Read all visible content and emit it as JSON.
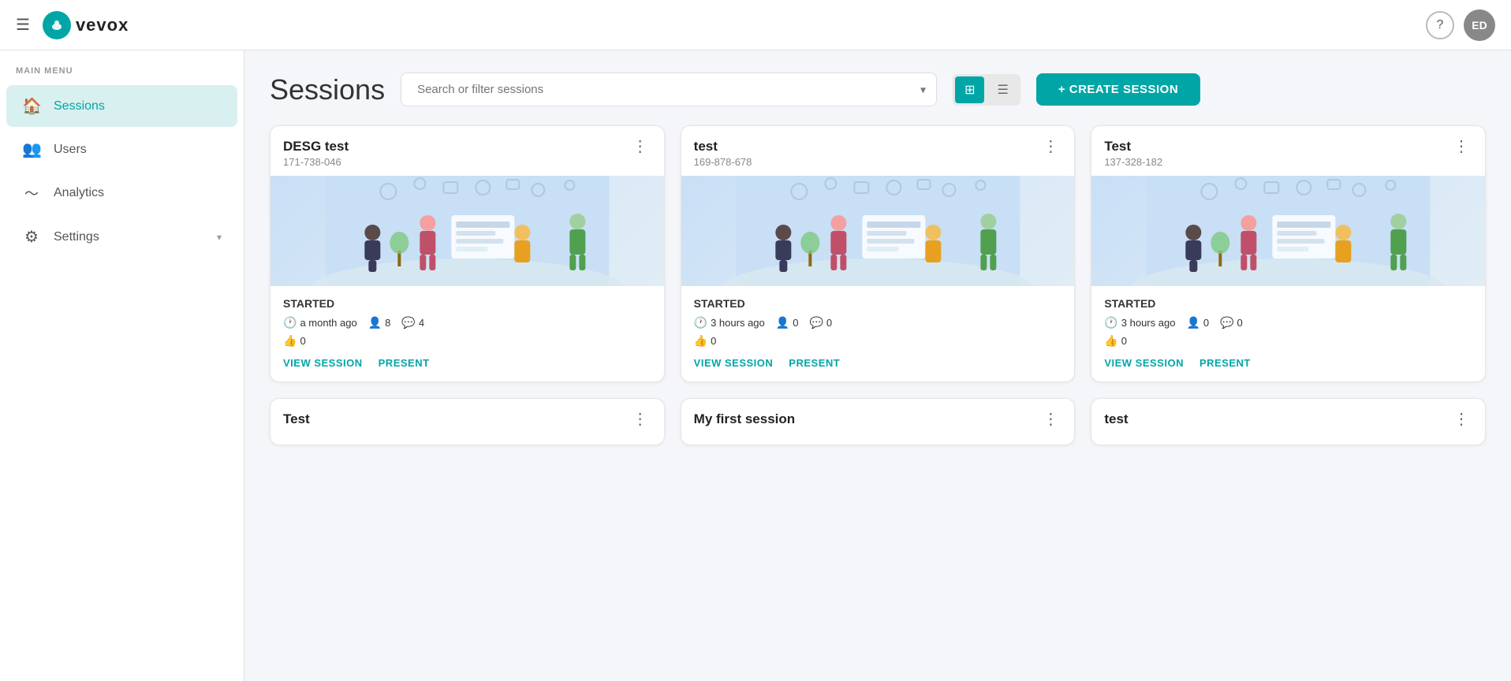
{
  "app": {
    "logo_text": "vevox",
    "avatar_initials": "ED"
  },
  "topbar": {
    "help_label": "?",
    "help_title": "Help"
  },
  "sidebar": {
    "section_label": "MAIN MENU",
    "items": [
      {
        "id": "sessions",
        "label": "Sessions",
        "icon": "🏠",
        "active": true
      },
      {
        "id": "users",
        "label": "Users",
        "icon": "👥",
        "active": false
      },
      {
        "id": "analytics",
        "label": "Analytics",
        "icon": "〜",
        "active": false
      },
      {
        "id": "settings",
        "label": "Settings",
        "icon": "⚙",
        "active": false,
        "has_chevron": true
      }
    ]
  },
  "page": {
    "title": "Sessions",
    "search_placeholder": "Search or filter sessions",
    "view_grid_label": "⊞",
    "view_list_label": "☰",
    "create_button_label": "+ CREATE SESSION"
  },
  "sessions": [
    {
      "id": 1,
      "title": "DESG test",
      "code": "171-738-046",
      "status": "STARTED",
      "time": "a month ago",
      "participants": 8,
      "messages": 4,
      "likes": 0,
      "view_label": "VIEW SESSION",
      "present_label": "PRESENT"
    },
    {
      "id": 2,
      "title": "test",
      "code": "169-878-678",
      "status": "STARTED",
      "time": "3 hours ago",
      "participants": 0,
      "messages": 0,
      "likes": 0,
      "view_label": "VIEW SESSION",
      "present_label": "PRESENT"
    },
    {
      "id": 3,
      "title": "Test",
      "code": "137-328-182",
      "status": "STARTED",
      "time": "3 hours ago",
      "participants": 0,
      "messages": 0,
      "likes": 0,
      "view_label": "VIEW SESSION",
      "present_label": "PRESENT"
    }
  ]
}
